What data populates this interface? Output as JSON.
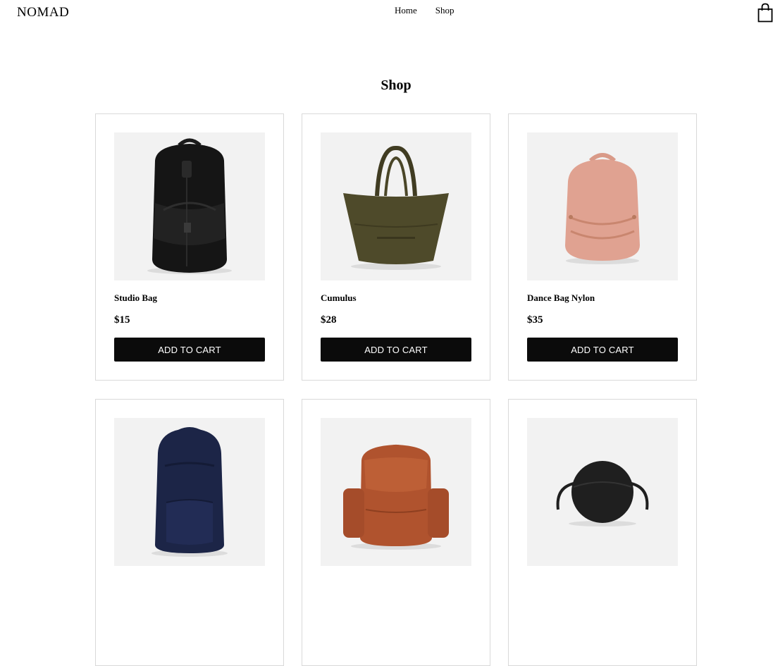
{
  "header": {
    "logo": "NOMAD",
    "nav": [
      {
        "label": "Home"
      },
      {
        "label": "Shop"
      }
    ],
    "cart_icon": "shopping-bag-icon"
  },
  "page": {
    "title": "Shop"
  },
  "products": [
    {
      "name": "Studio Bag",
      "price": "$15",
      "button": "ADD TO CART",
      "image": "black-backpack",
      "color": "#1a1a1a"
    },
    {
      "name": "Cumulus",
      "price": "$28",
      "button": "ADD TO CART",
      "image": "olive-tote",
      "color": "#4e4a2a"
    },
    {
      "name": "Dance Bag Nylon",
      "price": "$35",
      "button": "ADD TO CART",
      "image": "pink-backpack",
      "color": "#e0a291"
    },
    {
      "name": "",
      "price": "",
      "button": "",
      "image": "navy-backpack",
      "color": "#1c2547"
    },
    {
      "name": "",
      "price": "",
      "button": "",
      "image": "rust-backpack",
      "color": "#b0532e"
    },
    {
      "name": "",
      "price": "",
      "button": "",
      "image": "round-crossbody",
      "color": "#1f1f1f"
    }
  ]
}
